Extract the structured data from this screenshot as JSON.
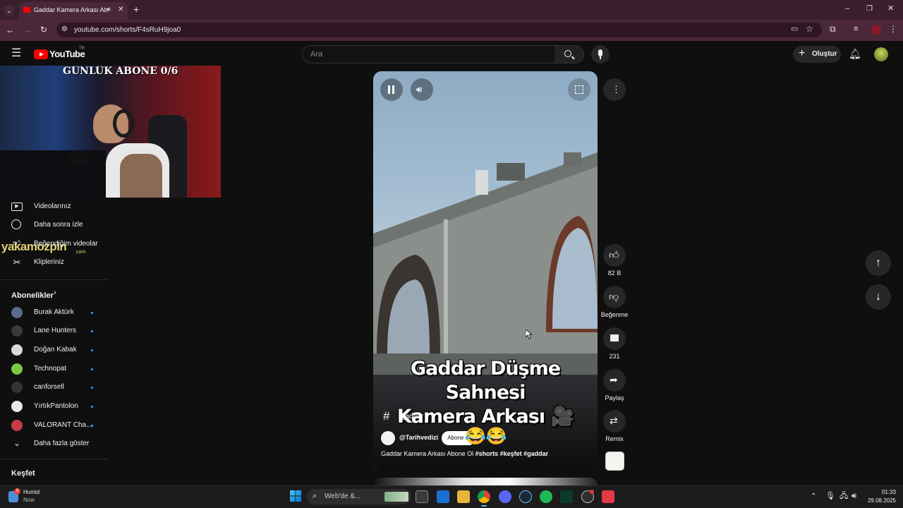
{
  "browser": {
    "tab_title": "Gaddar Kamera Arkası Abo",
    "new_tab": "+",
    "url": "youtube.com/shorts/F4sRuH9joa0"
  },
  "header": {
    "logo_text": "YouTube",
    "region": "TR",
    "search_placeholder": "Ara",
    "create_label": "Oluştur"
  },
  "overlay": {
    "stream_banner": "GÜNLÜK ABONE 0/6",
    "watermark": "yakamozpin",
    "watermark_sub": ".com"
  },
  "sidebar": {
    "you_items": [
      {
        "label": "Videolarınız",
        "icon": "video-icon"
      },
      {
        "label": "Daha sonra izle",
        "icon": "clock-icon"
      },
      {
        "label": "Beğendiğim videolar",
        "icon": "like-icon"
      },
      {
        "label": "Klipleriniz",
        "icon": "scissors-icon"
      }
    ],
    "subs_title": "Abonelikler",
    "subs": [
      {
        "label": "Burak Aktürk",
        "color": "#5a6b8c"
      },
      {
        "label": "Lane Hunters",
        "color": "#3a3a3a"
      },
      {
        "label": "Doğan Kabak",
        "color": "#d8d8d8"
      },
      {
        "label": "Technopat",
        "color": "#7ac943"
      },
      {
        "label": "canforsell",
        "color": "#333333"
      },
      {
        "label": "YırtıkPantolon",
        "color": "#e8e8e8"
      },
      {
        "label": "VALORANT Cha...",
        "color": "#c83c4a"
      }
    ],
    "more_label": "Daha fazla göster",
    "explore_title": "Keşfet"
  },
  "video": {
    "title_line1": "Gaddar Düşme Sahnesi",
    "title_line2": "Kamera Arkası 🎥",
    "hashtag": "gaddar",
    "channel": "@Tarihvedizi",
    "subscribe": "Abone ol",
    "emoji": "😂😂",
    "description": "Gaddar Kamera Arkası Abone Ol",
    "desc_tags": "#shorts #keşfet #gaddar"
  },
  "actions": {
    "likes": "82 B",
    "dislike": "Beğenme",
    "comments": "231",
    "share": "Paylaş",
    "remix": "Remix"
  },
  "taskbar": {
    "weather_title": "Humid",
    "weather_sub": "Now",
    "weather_badge": "8",
    "search_placeholder": "Web'de &...",
    "time": "01:33",
    "date": "29.08.2025"
  },
  "colors": {
    "accent": "#ff0000",
    "link_blue": "#3ea6ff"
  }
}
